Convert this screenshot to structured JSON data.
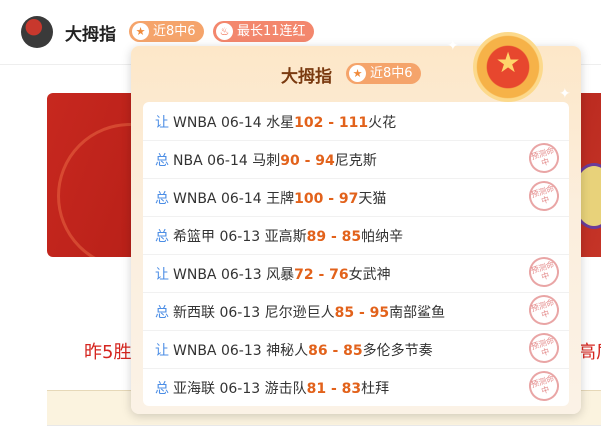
{
  "header": {
    "username": "大拇指",
    "record_badge": "近8中6",
    "streak_badge": "最长11连红",
    "record_icon": "star-icon",
    "streak_icon": "flame-icon"
  },
  "background": {
    "left_text": "昨5胜",
    "right_text": "高盾"
  },
  "popup": {
    "title": "大拇指",
    "badge": "近8中6",
    "medal_icon": "medal-star-icon",
    "stamp_text": "预测命中",
    "records": [
      {
        "type": "让",
        "league": "WNBA",
        "date": "06-14",
        "home": "水星",
        "home_score": "102",
        "sep": " - ",
        "away_score": "111",
        "away": "火花",
        "hit": false
      },
      {
        "type": "总",
        "league": "NBA",
        "date": "06-14",
        "home": "马刺",
        "home_score": "90",
        "sep": " - ",
        "away_score": "94",
        "away": "尼克斯",
        "hit": true
      },
      {
        "type": "总",
        "league": "WNBA",
        "date": "06-14",
        "home": "王牌",
        "home_score": "100",
        "sep": " - ",
        "away_score": "97",
        "away": "天猫",
        "hit": true
      },
      {
        "type": "总",
        "league": "希篮甲",
        "date": "06-13",
        "home": "亚高斯",
        "home_score": "89",
        "sep": " - ",
        "away_score": "85",
        "away": "帕纳辛",
        "hit": false
      },
      {
        "type": "让",
        "league": "WNBA",
        "date": "06-13",
        "home": "风暴",
        "home_score": "72",
        "sep": " - ",
        "away_score": "76",
        "away": "女武神",
        "hit": true
      },
      {
        "type": "总",
        "league": "新西联",
        "date": "06-13",
        "home": "尼尔逊巨人",
        "home_score": "85",
        "sep": " - ",
        "away_score": "95",
        "away": "南部鲨鱼",
        "hit": true
      },
      {
        "type": "让",
        "league": "WNBA",
        "date": "06-13",
        "home": "神秘人",
        "home_score": "86",
        "sep": " - ",
        "away_score": "85",
        "away": "多伦多节奏",
        "hit": true
      },
      {
        "type": "总",
        "league": "亚海联",
        "date": "06-13",
        "home": "游击队",
        "home_score": "81",
        "sep": " - ",
        "away_score": "83",
        "away": "杜拜",
        "hit": true
      }
    ]
  }
}
